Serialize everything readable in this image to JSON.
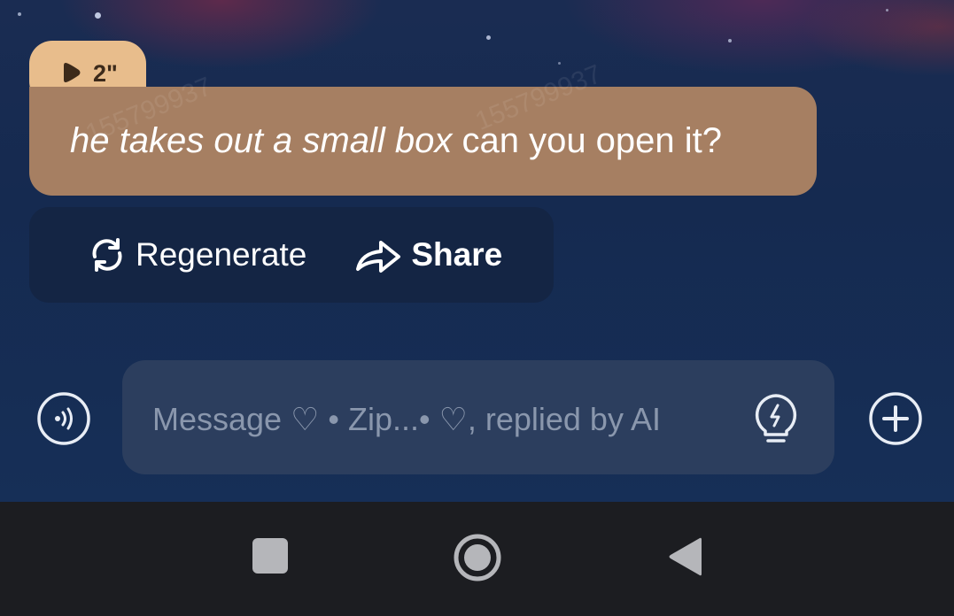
{
  "message": {
    "audio_duration": "2\"",
    "action_text": "he takes out a small box",
    "speech_text": " can you open it?",
    "watermark": "155799937"
  },
  "actions": {
    "regenerate_label": "Regenerate",
    "share_label": "Share"
  },
  "composer": {
    "placeholder": "Message ♡ • Zip...• ♡, replied by AI"
  },
  "icons": {
    "voice": "voice-mode-icon",
    "bulb": "lightbulb-icon",
    "plus": "plus-icon",
    "play": "play-icon",
    "regenerate": "refresh-icon",
    "share": "share-arrow-icon",
    "nav_recents": "square-icon",
    "nav_home": "circle-icon",
    "nav_back": "triangle-back-icon"
  },
  "colors": {
    "bubble": "#a67f62",
    "audio_tag": "#e8bd8c",
    "input_bg": "#2c3e5e",
    "navbar": "#1c1d21"
  }
}
